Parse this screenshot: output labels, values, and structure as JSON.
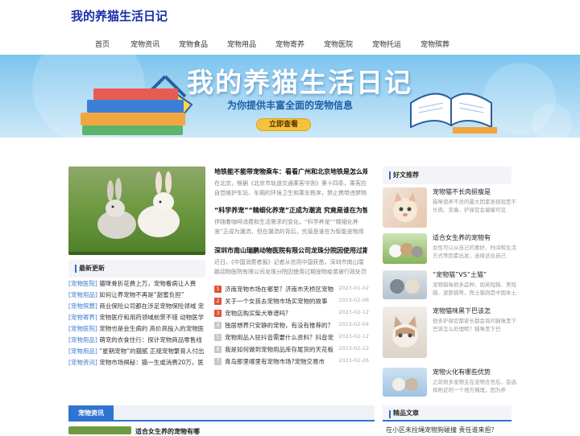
{
  "site": {
    "title": "我的养猫生活日记"
  },
  "nav": [
    "首页",
    "宠物资讯",
    "宠物食品",
    "宠物用品",
    "宠物寄养",
    "宠物医院",
    "宠物托运",
    "宠物殡葬"
  ],
  "banner": {
    "title": "我的养猫生活日记",
    "subtitle": "为你提供丰富全面的宠物信息",
    "button": "立即查看"
  },
  "featured": [
    {
      "title": "地铁能不能带宠物乘车：看看广州和北京地铁是怎么规定的",
      "desc": "在北京，根据《北京市轨道交通乘客守则》第十四条，乘客应自觉维护车站、车厢的环境卫生和乘车秩序，禁止携带违禁物品"
    },
    {
      "title": "“科学养宠”“精细化养宠”正成为潮流 究竟是谁在为智能宠物用品买单",
      "desc": "伴随着咖啡消费和生活需求的变化，“科学养宠”“精细化养宠”正成为潮流，但在潮流的背后，究竟是谁在为智能宠物用品"
    },
    {
      "title": "深圳市南山瑞鹏动物医院有限公司龙珠分院因使用过期宠物疫苗被行政处罚",
      "desc": "近日，《中国消费者报》记者从信用中国获悉，深圳市南山瑞鹏动物医院有限公司龙珠分院因使用过期宠物疫苗被行政处罚"
    }
  ],
  "latest": {
    "heading": "最新更新",
    "items": [
      {
        "tag": "[宠物医院]",
        "text": "猫咪骨折花费上万，宠物看病让人费"
      },
      {
        "tag": "[宠物用品]",
        "text": "如何让养宠物不再是“甜蜜负担”"
      },
      {
        "tag": "[宠物殡葬]",
        "text": "商业保险公司都在涉足宠物保险领域 宠"
      },
      {
        "tag": "[宠物寄养]",
        "text": "宠物医疗和用药领域前景不错 动物医学"
      },
      {
        "tag": "[宠物医院]",
        "text": "宠物也是会生病的 高价高投入的宠物医"
      },
      {
        "tag": "[宠物用品]",
        "text": "萌宠的衣食住行：探计宠物商品零售线"
      },
      {
        "tag": "[宠物用品]",
        "text": "“星期宠物”的猫腻 正规宠物繁育人付出"
      },
      {
        "tag": "[宠物资讯]",
        "text": "宠物市场揭秘：猫一生或消费20万，医"
      }
    ]
  },
  "ranked": [
    {
      "num": "1",
      "text": "济南宠物市场在哪里？济南市天桥区宠物",
      "date": "2023-01-02"
    },
    {
      "num": "2",
      "text": "关于一个女孩去宠物市场买宠物的故事",
      "date": "2023-02-06"
    },
    {
      "num": "3",
      "text": "宠物店购买柴犬靠谱吗？",
      "date": "2023-02-12"
    },
    {
      "num": "4",
      "text": "独居想养只安静的宠物，有没有推荐的？",
      "date": "2023-02-04"
    },
    {
      "num": "5",
      "text": "宠物用品入驻抖音需要什么资料？抖音宠",
      "date": "2023-02-12"
    },
    {
      "num": "6",
      "text": "我是如何做到宠物用品库存尾货的天花板",
      "date": "2023-02-22"
    },
    {
      "num": "7",
      "text": "青岛那里哪里有宠物市场?宠物交易市",
      "date": "2023-02-26"
    }
  ],
  "recommend": {
    "heading": "好文推荐",
    "items": [
      {
        "title": "宠物猫不长肉挺瘦是",
        "desc": "猫咪营养不良的最大因素表现就是不长肉、变瘦，铲屎官会偏瘦可见"
      },
      {
        "title": "适合女生养的宠物有",
        "desc": "女性可以从自己的喜好、时间和生活方式等因素出发，选择适合自己"
      },
      {
        "title": "“宠物猫”VS“土猫”",
        "desc": "宠物猫每很多品种，如英短猫、美短猫、波斯猫等，而土猫则是中国本土"
      },
      {
        "title": "宠物猫咪黑下巴该怎",
        "desc": "很多铲屎官都家长都会询问猫咪黑下巴该怎么处理呢？猫咪黑下巴"
      },
      {
        "title": "宠物火化有哪些优势",
        "desc": "之前很多宠物主在宠物去世后，会选择附近的一个地方掩埋，因为养"
      }
    ]
  },
  "bottom": {
    "tab": "宠物资讯",
    "preview": "适合女生养的宠物有哪"
  },
  "featured_articles": {
    "heading": "精品文章",
    "first": "在小区未拴绳宠物狗碰撞 责任谁来担？"
  },
  "colors": {
    "brand": "#1a2ea8",
    "accent": "#2f74d0",
    "hot": "#e2523a"
  }
}
